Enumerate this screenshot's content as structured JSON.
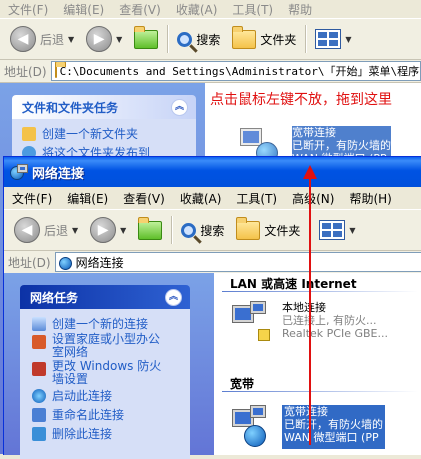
{
  "back_window": {
    "menu": [
      "文件(F)",
      "编辑(E)",
      "查看(V)",
      "收藏(A)",
      "工具(T)",
      "帮助"
    ],
    "toolbar": {
      "back": "后退",
      "search": "搜索",
      "folders": "文件夹"
    },
    "address": {
      "label": "地址(D)",
      "path": "C:\\Documents and Settings\\Administrator\\「开始」菜单\\程序\\"
    },
    "task_panel": {
      "title": "文件和文件夹任务",
      "items": [
        "创建一个新文件夹",
        "将这个文件夹发布到"
      ]
    },
    "annotation": "点击鼠标左键不放，拖到这里",
    "dragged_item": {
      "line1": "宽带连接",
      "line2": "已断开，有防火墙的",
      "line3": "WAN 微型端口 (PP"
    }
  },
  "front_window": {
    "title": "网络连接",
    "menu": [
      "文件(F)",
      "编辑(E)",
      "查看(V)",
      "收藏(A)",
      "工具(T)",
      "高级(N)",
      "帮助(H)"
    ],
    "toolbar": {
      "back": "后退",
      "search": "搜索",
      "folders": "文件夹"
    },
    "address": {
      "label": "地址(D)",
      "path": "网络连接"
    },
    "task_panel": {
      "title": "网络任务",
      "items": [
        "创建一个新的连接",
        "设置家庭或小型办公室网络",
        "更改 Windows 防火墙设置",
        "启动此连接",
        "重命名此连接",
        "删除此连接"
      ]
    },
    "groups": [
      {
        "title": "LAN 或高速 Internet",
        "connection": {
          "name": "本地连接",
          "status": "已连接上, 有防火...",
          "device": "Realtek PCIe GBE..."
        }
      },
      {
        "title": "宽带",
        "connection": {
          "name": "宽带连接",
          "status": "已断开，有防火墙的",
          "device": "WAN 微型端口 (PP"
        }
      }
    ]
  }
}
